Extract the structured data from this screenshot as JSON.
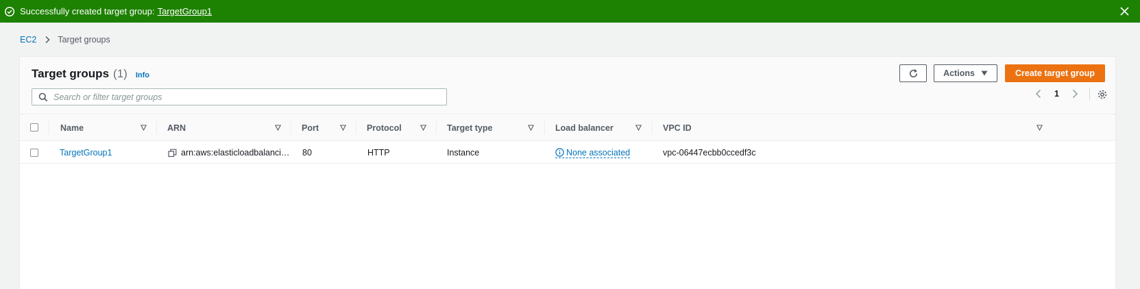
{
  "colors": {
    "success": "#1d8102",
    "primary_button": "#ec7211",
    "link": "#0073bb",
    "page_bg": "#f1f2f2"
  },
  "flash": {
    "message": "Successfully created target group:",
    "link_text": "TargetGroup1",
    "icon": "check-circle-icon",
    "close_icon": "close-icon"
  },
  "breadcrumb": {
    "items": [
      {
        "label": "EC2"
      },
      {
        "label": "Target groups"
      }
    ]
  },
  "header": {
    "title": "Target groups",
    "count": "(1)",
    "info": "Info",
    "refresh_icon": "refresh-icon",
    "actions_label": "Actions",
    "create_label": "Create target group"
  },
  "search": {
    "placeholder": "Search or filter target groups"
  },
  "pagination": {
    "page": "1"
  },
  "table": {
    "columns": [
      {
        "label": "Name"
      },
      {
        "label": "ARN"
      },
      {
        "label": "Port"
      },
      {
        "label": "Protocol"
      },
      {
        "label": "Target type"
      },
      {
        "label": "Load balancer"
      },
      {
        "label": "VPC ID"
      }
    ],
    "rows": [
      {
        "name": "TargetGroup1",
        "arn": "arn:aws:elasticloadbalanci…",
        "port": "80",
        "protocol": "HTTP",
        "target_type": "Instance",
        "load_balancer": "None associated",
        "vpc_id": "vpc-06447ecbb0ccedf3c"
      }
    ]
  }
}
